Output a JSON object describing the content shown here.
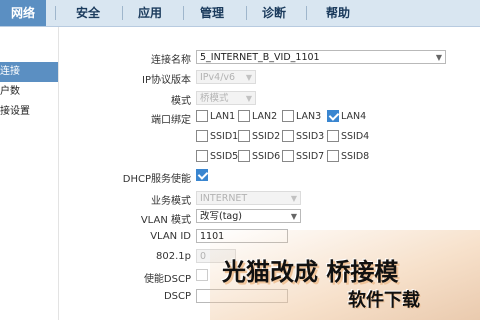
{
  "nav": {
    "items": [
      {
        "label": "网络"
      },
      {
        "label": "安全"
      },
      {
        "label": "应用"
      },
      {
        "label": "管理"
      },
      {
        "label": "诊断"
      },
      {
        "label": "帮助"
      }
    ]
  },
  "sidebar": {
    "items": [
      {
        "label": "连接"
      },
      {
        "label": "户数"
      },
      {
        "label": "接设置"
      }
    ]
  },
  "form": {
    "connection_name": {
      "label": "连接名称",
      "value": "5_INTERNET_B_VID_1101"
    },
    "ip_version": {
      "label": "IP协议版本",
      "value": "IPv4/v6"
    },
    "mode": {
      "label": "模式",
      "value": "桥模式"
    },
    "port_binding": {
      "label": "端口绑定",
      "options": [
        {
          "label": "LAN1",
          "checked": false
        },
        {
          "label": "LAN2",
          "checked": false
        },
        {
          "label": "LAN3",
          "checked": false
        },
        {
          "label": "LAN4",
          "checked": true
        },
        {
          "label": "SSID1",
          "checked": false
        },
        {
          "label": "SSID2",
          "checked": false
        },
        {
          "label": "SSID3",
          "checked": false
        },
        {
          "label": "SSID4",
          "checked": false
        },
        {
          "label": "SSID5",
          "checked": false
        },
        {
          "label": "SSID6",
          "checked": false
        },
        {
          "label": "SSID7",
          "checked": false
        },
        {
          "label": "SSID8",
          "checked": false
        }
      ]
    },
    "dhcp": {
      "label": "DHCP服务使能",
      "checked": true
    },
    "service_mode": {
      "label": "业务模式",
      "value": "INTERNET"
    },
    "vlan_mode": {
      "label": "VLAN 模式",
      "value": "改写(tag)"
    },
    "vlan_id": {
      "label": "VLAN ID",
      "value": "1101"
    },
    "dot1p": {
      "label": "802.1p",
      "value": "0"
    },
    "dscp_enable": {
      "label": "使能DSCP",
      "checked": false
    },
    "dscp": {
      "label": "DSCP",
      "value": ""
    }
  },
  "overlay": {
    "headline": "光猫改成 桥接模",
    "watermark": "软件下载"
  }
}
